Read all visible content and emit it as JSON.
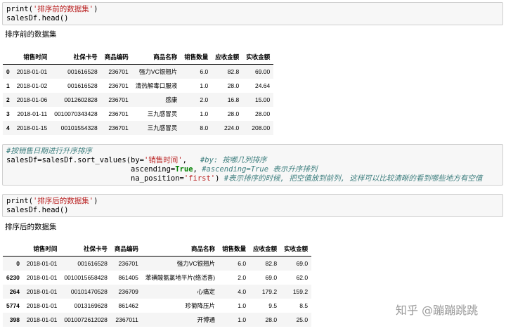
{
  "cell1": {
    "line1": {
      "fn": "print(",
      "str": "'排序前的数据集'",
      "end": ")"
    },
    "line2": "salesDf.head()",
    "output_label": "排序前的数据集"
  },
  "table1": {
    "columns": [
      "",
      "销售时间",
      "社保卡号",
      "商品编码",
      "商品名称",
      "销售数量",
      "应收金额",
      "实收金额"
    ],
    "rows": [
      [
        "0",
        "2018-01-01",
        "001616528",
        "236701",
        "强力VC银翘片",
        "6.0",
        "82.8",
        "69.00"
      ],
      [
        "1",
        "2018-01-02",
        "001616528",
        "236701",
        "清热解毒口服液",
        "1.0",
        "28.0",
        "24.64"
      ],
      [
        "2",
        "2018-01-06",
        "0012602828",
        "236701",
        "感康",
        "2.0",
        "16.8",
        "15.00"
      ],
      [
        "3",
        "2018-01-11",
        "0010070343428",
        "236701",
        "三九感冒灵",
        "1.0",
        "28.0",
        "28.00"
      ],
      [
        "4",
        "2018-01-15",
        "00101554328",
        "236701",
        "三九感冒灵",
        "8.0",
        "224.0",
        "208.00"
      ]
    ]
  },
  "cell2": {
    "comment_line": "#按销售日期进行升序排序",
    "l2_code": "salesDf=salesDf.sort_values(by=",
    "l2_str": "'销售时间'",
    "l2_sep": ",   ",
    "l2_cmt": "#by: 按哪几列排序",
    "l3_code": "ascending=",
    "l3_kw": "True",
    "l3_sep": ", ",
    "l3_cmt": "#ascending=True 表示升序排列",
    "l4_code": "na_position=",
    "l4_str": "'first'",
    "l4_sep": ") ",
    "l4_cmt": "#表示排序的时候, 把空值放到前列, 这样可以比较清晰的看到哪些地方有空值"
  },
  "cell3": {
    "line1": {
      "fn": "print(",
      "str": "'排序后的数据集'",
      "end": ")"
    },
    "line2": "salesDf.head()",
    "output_label": "排序后的数据集"
  },
  "table2": {
    "columns": [
      "",
      "销售时间",
      "社保卡号",
      "商品编码",
      "商品名称",
      "销售数量",
      "应收金额",
      "实收金额"
    ],
    "rows": [
      [
        "0",
        "2018-01-01",
        "001616528",
        "236701",
        "强力VC银翘片",
        "6.0",
        "82.8",
        "69.0"
      ],
      [
        "6230",
        "2018-01-01",
        "0010015658428",
        "861405",
        "苯磺酸氨氯地平片(络活喜)",
        "2.0",
        "69.0",
        "62.0"
      ],
      [
        "264",
        "2018-01-01",
        "00101470528",
        "236709",
        "心痛定",
        "4.0",
        "179.2",
        "159.2"
      ],
      [
        "5774",
        "2018-01-01",
        "0013169628",
        "861462",
        "珍菊降压片",
        "1.0",
        "9.5",
        "8.5"
      ],
      [
        "398",
        "2018-01-01",
        "0010072612028",
        "2367011",
        "开博通",
        "1.0",
        "28.0",
        "25.0"
      ]
    ]
  },
  "watermark": "知乎 @蹦蹦跳跳"
}
